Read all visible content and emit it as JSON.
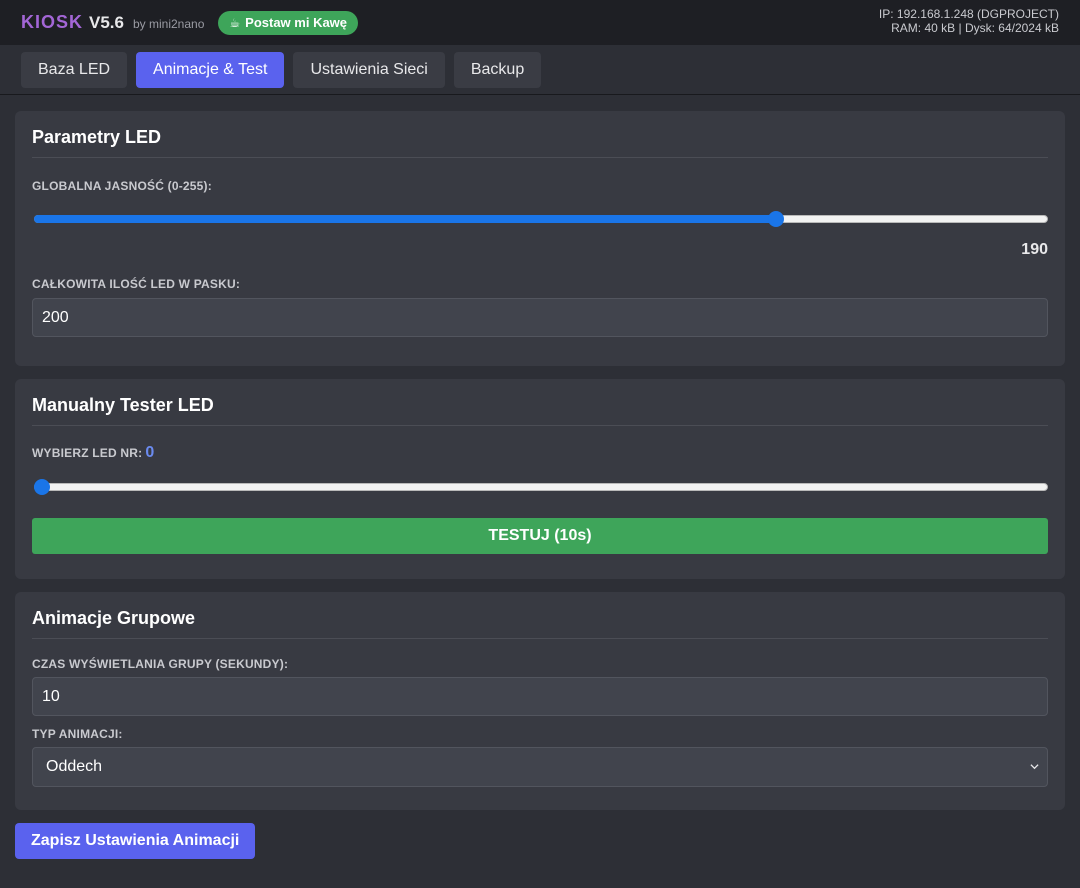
{
  "header": {
    "brand": "KIOSK",
    "version": "V5.6",
    "byline": "by mini2nano",
    "coffee_icon": "☕",
    "coffee_label": "Postaw mi Kawę",
    "ip_line": "IP: 192.168.1.248 (DGPROJECT)",
    "mem_line": "RAM: 40 kB | Dysk: 64/2024 kB"
  },
  "tabs": [
    {
      "label": "Baza LED",
      "active": false
    },
    {
      "label": "Animacje & Test",
      "active": true
    },
    {
      "label": "Ustawienia Sieci",
      "active": false
    },
    {
      "label": "Backup",
      "active": false
    }
  ],
  "led_params": {
    "title": "Parametry LED",
    "brightness_label": "GLOBALNA JASNOŚĆ (0-255):",
    "brightness_value": "190",
    "brightness_fraction": 0.737,
    "count_label": "CAŁKOWITA ILOŚĆ LED W PASKU:",
    "count_value": "200"
  },
  "tester": {
    "title": "Manualny Tester LED",
    "select_label": "WYBIERZ LED NR:",
    "led_number": "0",
    "slider_fraction": 0.0,
    "test_button": "TESTUJ (10s)"
  },
  "group_anim": {
    "title": "Animacje Grupowe",
    "time_label": "CZAS WYŚWIETLANIA GRUPY (SEKUNDY):",
    "time_value": "10",
    "type_label": "TYP ANIMACJI:",
    "type_value": "Oddech"
  },
  "save_button": "Zapisz Ustawienia Animacji",
  "colors": {
    "accent": "#5a62ee",
    "success": "#3ea55a",
    "brand": "#a366d6",
    "slider": "#1a75e8"
  }
}
